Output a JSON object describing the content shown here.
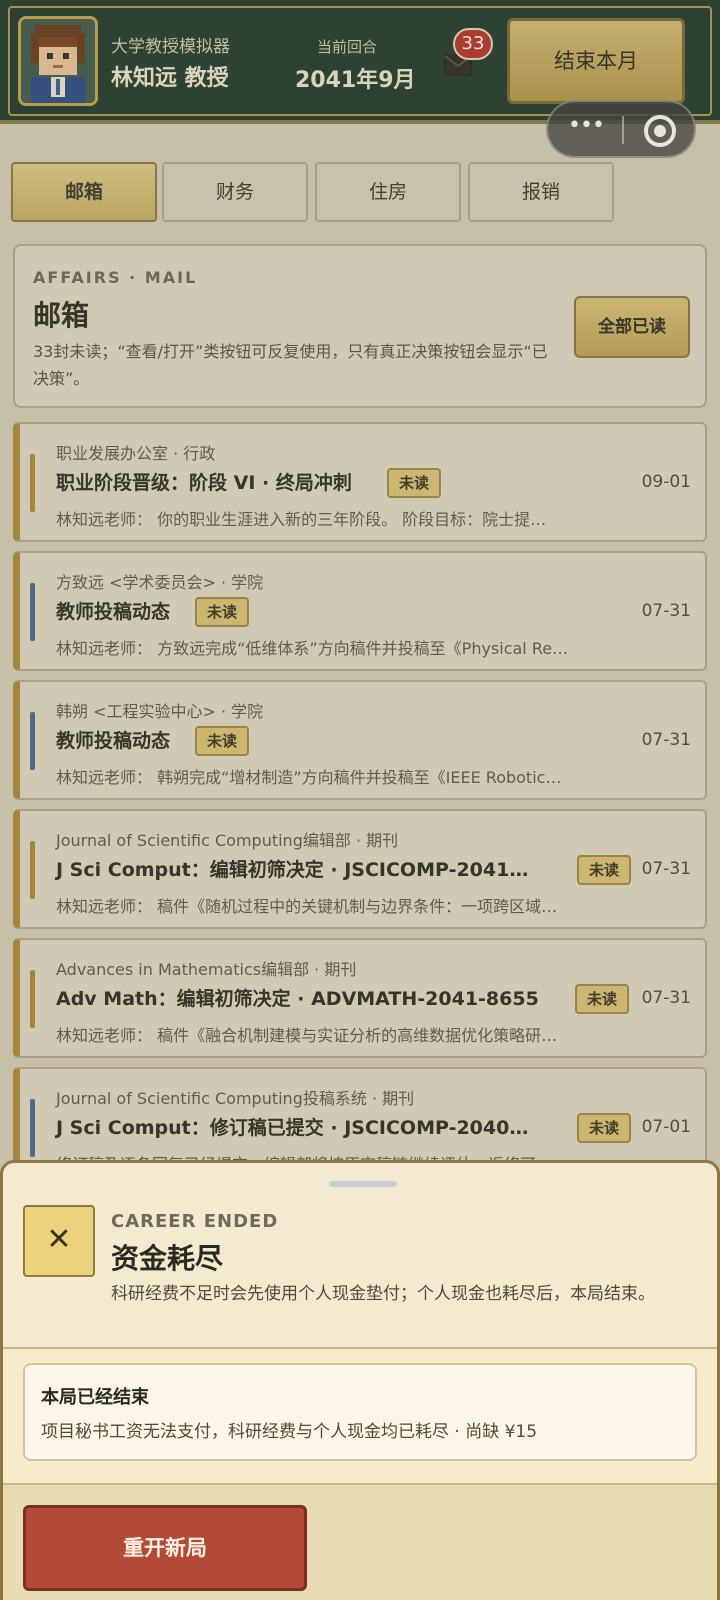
{
  "header": {
    "game_title": "大学教授模拟器",
    "player_name": "林知远 教授",
    "round_label": "当前回合",
    "round_value": "2041年9月",
    "mail_unread_count": "33",
    "end_month_label": "结束本月",
    "mail_icon": "mail-icon"
  },
  "tabs": [
    {
      "label": "邮箱",
      "active": true
    },
    {
      "label": "财务",
      "active": false
    },
    {
      "label": "住房",
      "active": false
    },
    {
      "label": "报销",
      "active": false
    }
  ],
  "mailbox": {
    "eyebrow": "AFFAIRS · MAIL",
    "title": "邮箱",
    "description": "33封未读；“查看/打开”类按钮可反复使用，只有真正决策按钮会显示“已决策”。",
    "mark_all_read_label": "全部已读"
  },
  "mails": [
    {
      "sender": "职业发展办公室 · 行政",
      "subject": "职业阶段晋级：阶段 VI · 终局冲刺",
      "badge": "未读",
      "date": "09-01",
      "preview": "林知远老师： 你的职业生涯进入新的三年阶段。 阶段目标：院士提…",
      "stripe_color": "#b08c3a"
    },
    {
      "sender": "方致远 <学术委员会> · 学院",
      "subject": "教师投稿动态",
      "badge": "未读",
      "date": "07-31",
      "preview": "林知远老师： 方致远完成“低维体系”方向稿件并投稿至《Physical Re…",
      "stripe_color": "#4a6a96"
    },
    {
      "sender": "韩朔 <工程实验中心> · 学院",
      "subject": "教师投稿动态",
      "badge": "未读",
      "date": "07-31",
      "preview": "林知远老师： 韩朔完成“增材制造”方向稿件并投稿至《IEEE Robotic…",
      "stripe_color": "#4a6a96"
    },
    {
      "sender": "Journal of Scientific Computing编辑部 · 期刊",
      "subject": "J Sci Comput：编辑初筛决定 · JSCICOMP-2041…",
      "badge": "未读",
      "date": "07-31",
      "preview": "林知远老师： 稿件《随机过程中的关键机制与边界条件：一项跨区域…",
      "stripe_color": "#b08c3a"
    },
    {
      "sender": "Advances in Mathematics编辑部 · 期刊",
      "subject": "Adv Math：编辑初筛决定 · ADVMATH-2041-8655",
      "badge": "未读",
      "date": "07-31",
      "preview": "林知远老师： 稿件《融合机制建模与实证分析的高维数据优化策略研…",
      "stripe_color": "#b08c3a"
    },
    {
      "sender": "Journal of Scientific Computing投稿系统 · 期刊",
      "subject": "J Sci Comput：修订稿已提交 · JSCICOMP-2040…",
      "badge": "未读",
      "date": "07-01",
      "preview": "修订稿及逐条回复已经提交，编辑部将按原审稿链继续评估。返修可…",
      "stripe_color": "#4a6a96"
    }
  ],
  "career_sheet": {
    "eyebrow": "CAREER ENDED",
    "title": "资金耗尽",
    "description": "科研经费不足时会先使用个人现金垫付；个人现金也耗尽后，本局结束。",
    "close_icon": "close-icon",
    "over_title": "本局已经结束",
    "over_description": "项目秘书工资无法支付，科研经费与个人现金均已耗尽 · 尚缺 ¥15",
    "restart_label": "重开新局"
  },
  "colors": {
    "header_bg": "#1f3a2c",
    "gold_accent": "#c9a94d",
    "danger": "#b34a37",
    "badge_red": "#b8332e"
  }
}
